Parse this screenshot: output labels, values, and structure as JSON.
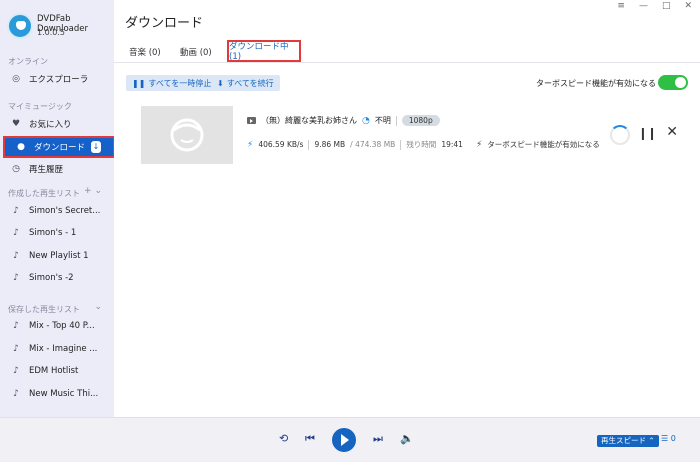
{
  "app": {
    "name": "DVDFab Downloader",
    "version": "1.0.0.5"
  },
  "sidebar": {
    "online_label": "オンライン",
    "explorer": "エクスプローラ",
    "my_music_label": "マイミュージック",
    "favorites": "お気に入り",
    "download": "ダウンロード",
    "history": "再生履歴",
    "created_label": "作成した再生リスト",
    "created_playlists": [
      "Simon's Secret...",
      "Simon's - 1",
      "New Playlist 1",
      "Simon's -2"
    ],
    "saved_label": "保存した再生リスト",
    "saved_playlists": [
      "Mix - Top 40 P...",
      "Mix - Imagine ...",
      "EDM Hotlist",
      "New Music Thi..."
    ]
  },
  "main": {
    "title": "ダウンロード",
    "tabs": [
      "音楽 (0)",
      "動画 (0)",
      "ダウンロード中 (1)"
    ],
    "pause_all": "すべてを一時停止",
    "resume_all": "すべてを続行",
    "turbo_label": "ターボスピード機能が有効になる",
    "item": {
      "title": "（無）綺麗な美乳お姉さん",
      "duration": "不明",
      "quality": "1080p",
      "speed": "406.59 KB/s",
      "downloaded": "9.86 MB",
      "total": "/ 474.38 MB",
      "remaining_label": "残り時間",
      "remaining": "19:41",
      "turbo_note": "ターボスピード機能が有効になる"
    }
  },
  "player": {
    "speed_label": "再生スピード",
    "queue_count": "0"
  },
  "colors": {
    "accent": "#1565c0",
    "toggle_on": "#2fbf45",
    "highlight": "#e23a3a",
    "sidebar_bg": "#ecebf8"
  }
}
